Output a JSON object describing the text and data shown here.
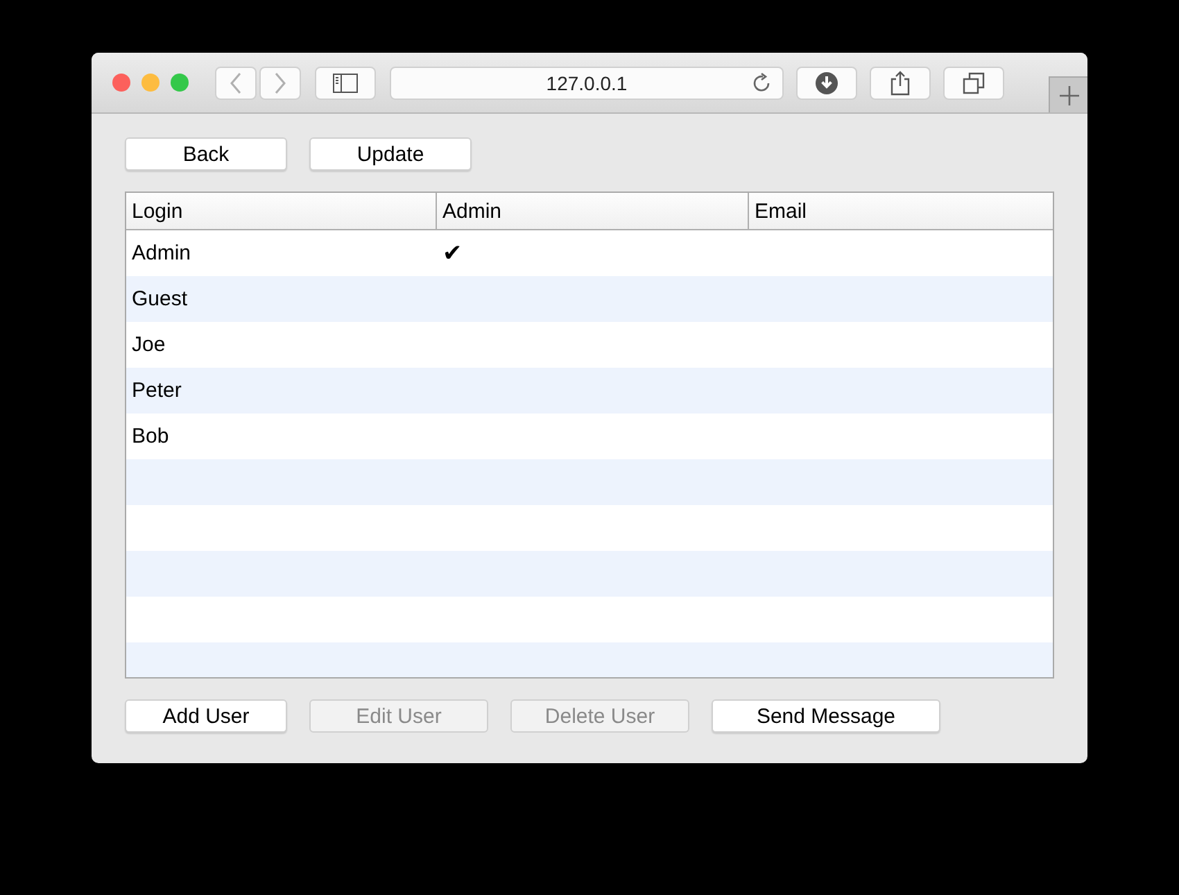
{
  "browser": {
    "address": "127.0.0.1"
  },
  "top_buttons": [
    {
      "label": "Back",
      "disabled": false
    },
    {
      "label": "Update",
      "disabled": false
    }
  ],
  "table": {
    "columns": [
      "Login",
      "Admin",
      "Email"
    ],
    "rows": [
      {
        "login": "Admin",
        "admin": "✔"
      },
      {
        "login": "Guest"
      },
      {
        "login": "Joe"
      },
      {
        "login": "Peter"
      },
      {
        "login": "Bob"
      }
    ]
  },
  "bottom_buttons": [
    {
      "label": "Add User",
      "disabled": false
    },
    {
      "label": "Edit User",
      "disabled": true
    },
    {
      "label": "Delete User",
      "disabled": true
    },
    {
      "label": "Send Message",
      "disabled": false
    }
  ]
}
